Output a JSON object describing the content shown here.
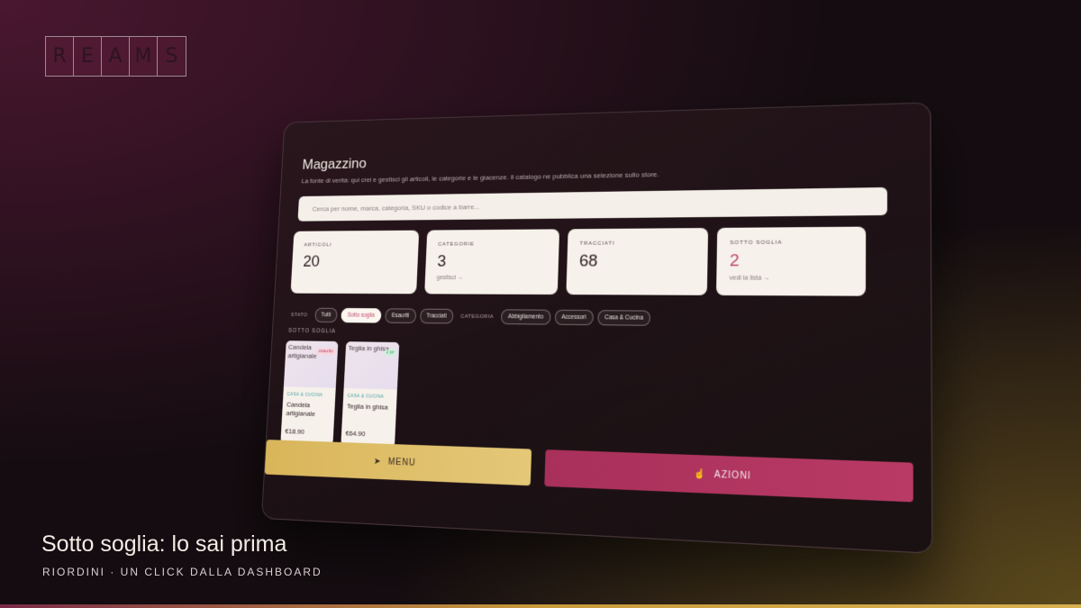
{
  "logo": {
    "letters": [
      "R",
      "E",
      "A",
      "M",
      "S"
    ]
  },
  "panel": {
    "title": "Magazzino",
    "subtitle": "La fonte di verità: qui crei e gestisci gli articoli, le categorie e le giacenze. Il catalogo ne pubblica una selezione sullo store.",
    "search_placeholder": "Cerca per nome, marca, categoria, SKU o codice a barre...",
    "stats": [
      {
        "label": "ARTICOLI",
        "value": "20",
        "link": ""
      },
      {
        "label": "CATEGORIE",
        "value": "3",
        "link": "gestisci →"
      },
      {
        "label": "TRACCIATI",
        "value": "68",
        "link": ""
      },
      {
        "label": "SOTTO SOGLIA",
        "value": "2",
        "link": "vedi la lista →"
      }
    ],
    "filters": {
      "stato_label": "STATO",
      "stato": [
        "Tutti",
        "Sotto soglia",
        "Esauriti",
        "Tracciati"
      ],
      "stato_active": "Sotto soglia",
      "categoria_label": "CATEGORIA",
      "categoria": [
        "Abbigliamento",
        "Accessori",
        "Casa & Cucina"
      ]
    },
    "section_label": "SOTTO SOGLIA",
    "products": [
      {
        "img_alt": "Candela artigianale",
        "badge": "esaurito",
        "badge_color": "red",
        "category": "CASA & CUCINA",
        "name": "Candela artigianale",
        "price": "€18.90"
      },
      {
        "img_alt": "Teglia in ghisa",
        "badge": "2 pz",
        "badge_color": "green",
        "category": "CASA & CUCINA",
        "name": "Teglia in ghisa",
        "price": "€64.90"
      }
    ],
    "menu_button": "MENU",
    "actions_button": "AZIONI"
  },
  "caption": {
    "title": "Sotto soglia: lo sai prima",
    "subtitle": "RIORDINI · UN CLICK DALLA DASHBOARD"
  },
  "colors": {
    "accent_red": "#c04a70",
    "accent_gold": "#d9b55a",
    "card_bg": "#f6f1ea"
  }
}
